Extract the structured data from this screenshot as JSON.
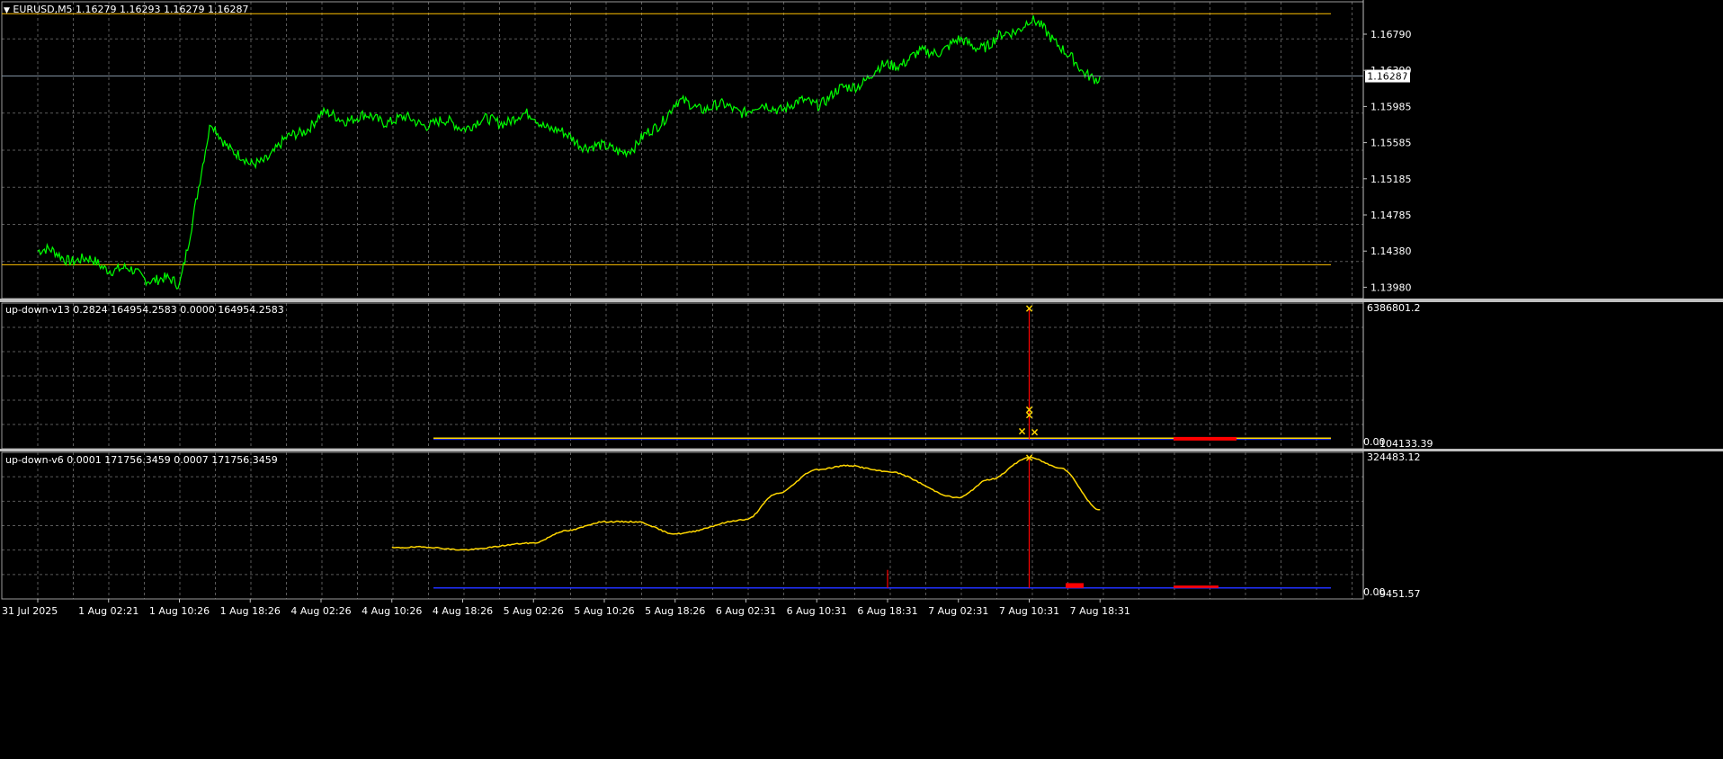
{
  "main": {
    "header_icon": "triangle-down-icon",
    "header": "EURUSD,M5  1.16279 1.16293 1.16279 1.16287",
    "price_labels": [
      "1.16790",
      "1.16390",
      "1.15985",
      "1.15585",
      "1.15185",
      "1.14785",
      "1.14380",
      "1.13980"
    ],
    "current_price": "1.16287"
  },
  "sub1": {
    "header": "up-down-v13 0.2824 164954.2583 0.0000 164954.2583",
    "top_label": "6386801.2",
    "bottom_label": "0.00",
    "bottom_label2": "-104133.39"
  },
  "sub2": {
    "header": "up-down-v6 0.0001 171756.3459 0.0007 171756.3459",
    "top_label": "324483.12",
    "bottom_label": "0.00",
    "bottom_label2": "-9451.57"
  },
  "time_labels": [
    "31 Jul 2025",
    "1 Aug 02:21",
    "1 Aug 10:26",
    "1 Aug 18:26",
    "4 Aug 02:26",
    "4 Aug 10:26",
    "4 Aug 18:26",
    "5 Aug 02:26",
    "5 Aug 10:26",
    "5 Aug 18:26",
    "6 Aug 02:31",
    "6 Aug 10:31",
    "6 Aug 18:31",
    "7 Aug 02:31",
    "7 Aug 10:31",
    "7 Aug 18:31"
  ],
  "colors": {
    "background": "#000000",
    "grid": "#5a5a5a",
    "price_line": "#00ff00",
    "level_line": "#ffc000",
    "indicator_line": "#ffd700",
    "spike": "#ff0000",
    "baseline": "#2030ff",
    "marker": "#ffd700",
    "text": "#ffffff",
    "current_line": "#8090a0"
  },
  "chart_data": [
    {
      "type": "line",
      "title": "EURUSD,M5",
      "x": [
        "31 Jul 2025",
        "1 Aug 02:21",
        "1 Aug 10:26",
        "1 Aug 14:00",
        "1 Aug 18:26",
        "4 Aug 02:26",
        "4 Aug 10:26",
        "4 Aug 18:26",
        "5 Aug 02:26",
        "5 Aug 06:00",
        "5 Aug 10:26",
        "5 Aug 14:00",
        "5 Aug 18:26",
        "6 Aug 02:31",
        "6 Aug 06:00",
        "6 Aug 10:31",
        "6 Aug 14:00",
        "6 Aug 18:31",
        "7 Aug 02:31",
        "7 Aug 06:00",
        "7 Aug 08:30",
        "7 Aug 10:31",
        "7 Aug 14:00",
        "7 Aug 16:30",
        "7 Aug 18:31"
      ],
      "series": [
        {
          "values": [
            1.1438,
            1.142,
            1.14,
            1.1575,
            1.1528,
            1.1585,
            1.1581,
            1.1575,
            1.1585,
            1.1562,
            1.1548,
            1.155,
            1.1598,
            1.1592,
            1.1595,
            1.16,
            1.1615,
            1.164,
            1.1665,
            1.1662,
            1.1678,
            1.169,
            1.1665,
            1.163,
            1.1629
          ]
        }
      ],
      "levels": [
        1.1697,
        1.1422
      ],
      "current_price": 1.16287,
      "ylim": [
        1.1385,
        1.171
      ],
      "grid": true
    },
    {
      "type": "line",
      "title": "up-down-v13",
      "spike": {
        "x": "7 Aug 10:31",
        "value": 6386801.2
      },
      "markers": [
        6386801.2,
        1450000,
        1200000,
        400000,
        350000
      ],
      "ylim": [
        -104133.39,
        6386801.2
      ],
      "grid": true
    },
    {
      "type": "line",
      "title": "up-down-v6",
      "x": [
        "4 Aug 10:26",
        "4 Aug 14:00",
        "4 Aug 18:26",
        "5 Aug 02:26",
        "5 Aug 06:00",
        "5 Aug 10:26",
        "5 Aug 14:00",
        "5 Aug 18:26",
        "6 Aug 02:31",
        "6 Aug 06:00",
        "6 Aug 10:31",
        "6 Aug 14:00",
        "6 Aug 18:31",
        "7 Aug 02:31",
        "7 Aug 06:00",
        "7 Aug 10:31",
        "7 Aug 14:00",
        "7 Aug 18:31"
      ],
      "series": [
        {
          "values": [
            100000,
            102000,
            95000,
            112000,
            142000,
            165000,
            165000,
            135000,
            170000,
            235000,
            295000,
            305000,
            290000,
            225000,
            270000,
            325000,
            300000,
            195000
          ]
        }
      ],
      "spikes": [
        {
          "x": "6 Aug 18:31",
          "value": 45000
        },
        {
          "x": "7 Aug 10:31",
          "value": 324483.12
        }
      ],
      "ylim": [
        -9451.57,
        324483.12
      ],
      "grid": true
    }
  ]
}
